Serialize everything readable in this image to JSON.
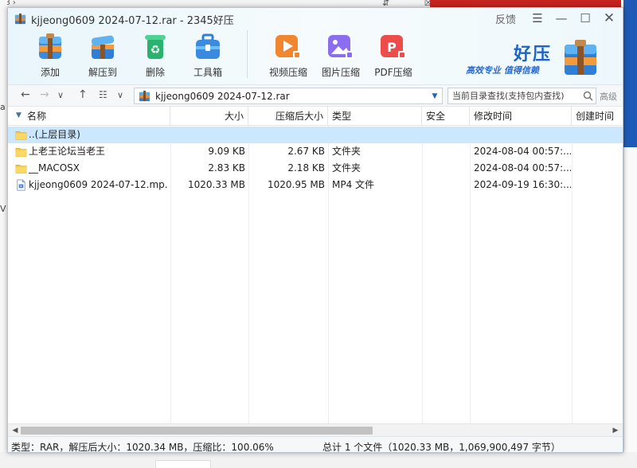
{
  "window": {
    "title": "kjjeong0609 2024-07-12.rar - 2345好压",
    "feedback_label": "反馈"
  },
  "toolbar": {
    "add": "添加",
    "extract_to": "解压到",
    "delete": "删除",
    "toolbox": "工具箱",
    "video_compress": "视频压缩",
    "image_compress": "图片压缩",
    "pdf_compress": "PDF压缩"
  },
  "brand": {
    "name": "好压",
    "slogan": "高效专业  值得信赖"
  },
  "navbar": {
    "path": "kjjeong0609 2024-07-12.rar",
    "search_placeholder": "当前目录查找(支持包内查找)",
    "advanced_label": "高级"
  },
  "columns": {
    "name": "名称",
    "size": "大小",
    "packed": "压缩后大小",
    "type": "类型",
    "security": "安全",
    "modified": "修改时间",
    "created": "创建时间"
  },
  "files": [
    {
      "icon": "folder-icon",
      "name": "..(上层目录)",
      "size": "",
      "packed": "",
      "type": "",
      "security": "",
      "modified": "",
      "selected": true
    },
    {
      "icon": "folder-icon",
      "name": "上老王论坛当老王",
      "size": "9.09 KB",
      "packed": "2.67 KB",
      "type": "文件夹",
      "security": "",
      "modified": "2024-08-04 00:57:...",
      "selected": false
    },
    {
      "icon": "folder-icon",
      "name": "__MACOSX",
      "size": "2.83 KB",
      "packed": "2.18 KB",
      "type": "文件夹",
      "security": "",
      "modified": "2024-08-04 00:57:...",
      "selected": false
    },
    {
      "icon": "video-file-icon",
      "name": "kjjeong0609 2024-07-12.mp...",
      "size": "1020.33 MB",
      "packed": "1020.95 MB",
      "type": "MP4 文件",
      "security": "",
      "modified": "2024-09-19 16:30:...",
      "selected": false
    }
  ],
  "status": {
    "left": "类型：RAR，解压后大小：1020.34 MB，压缩比：100.06%",
    "right": "总计 1 个文件（1020.33 MB，1,069,900,497 字节）"
  },
  "colors": {
    "selected_row": "#cce8ff",
    "brand_blue": "#1f63c6",
    "folder_yellow": "#f5c842"
  }
}
